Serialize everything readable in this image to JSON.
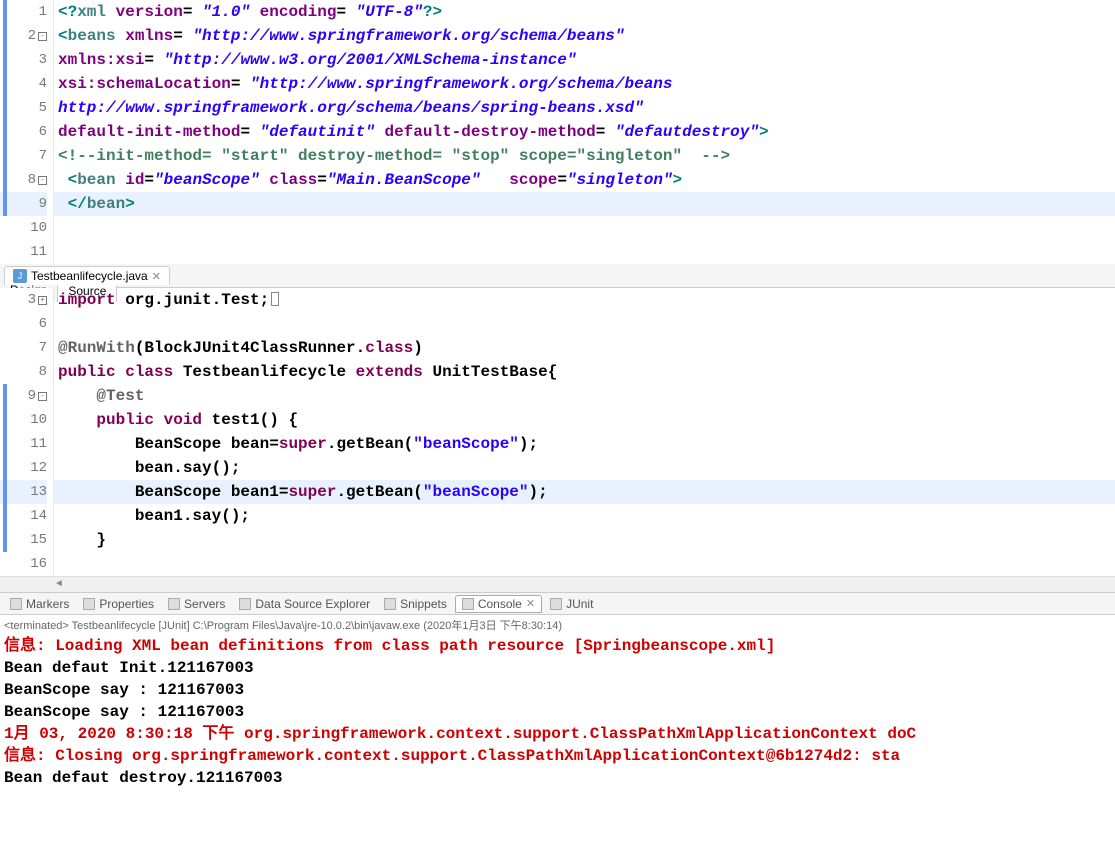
{
  "xml_editor": {
    "lines": [
      {
        "n": "1",
        "marker": "strip"
      },
      {
        "n": "2",
        "marker": "box-minus strip"
      },
      {
        "n": "3",
        "marker": "strip"
      },
      {
        "n": "4",
        "marker": "strip"
      },
      {
        "n": "5",
        "marker": "strip"
      },
      {
        "n": "6",
        "marker": "strip"
      },
      {
        "n": "7",
        "marker": "strip"
      },
      {
        "n": "8",
        "marker": "box-minus strip"
      },
      {
        "n": "9",
        "marker": "strip",
        "hl": true
      },
      {
        "n": "10",
        "marker": ""
      },
      {
        "n": "11",
        "marker": ""
      }
    ],
    "tokens": {
      "l1": {
        "a": "<?",
        "b": "xml ",
        "c": "version",
        "d": "= ",
        "e": "\"1.0\"",
        "f": " encoding",
        "g": "= ",
        "h": "\"UTF-8\"",
        "i": "?>"
      },
      "l2": {
        "a": "<",
        "b": "beans ",
        "c": "xmlns",
        "d": "= ",
        "e": "\"http://www.springframework.org/schema/beans\""
      },
      "l3": {
        "a": "xmlns:xsi",
        "b": "= ",
        "c": "\"http://www.w3.org/2001/XMLSchema-instance\""
      },
      "l4": {
        "a": "xsi:schemaLocation",
        "b": "= ",
        "c": "\"http://www.springframework.org/schema/beans"
      },
      "l5": {
        "a": "http://www.springframework.org/schema/beans/spring-beans.xsd\""
      },
      "l6": {
        "a": "default-init-method",
        "b": "= ",
        "c": "\"defautinit\"",
        "d": " default-destroy-method",
        "e": "= ",
        "f": "\"defautdestroy\"",
        "g": ">"
      },
      "l7": {
        "a": "<!--init-method= \"start\" destroy-method= \"stop\" scope=\"singleton\"  -->"
      },
      "l8": {
        "a": " <",
        "b": "bean ",
        "c": "id",
        "d": "=",
        "e": "\"beanScope\"",
        "f": " class",
        "g": "=",
        "h": "\"Main.BeanScope\"",
        "i": "   scope",
        "j": "=",
        "k": "\"singleton\"",
        "l": ">"
      },
      "l9": {
        "a": " </",
        "b": "bean",
        "c": ">"
      }
    },
    "tabs": {
      "design": "Design",
      "source": "Source"
    }
  },
  "java_file_tab": {
    "label": "Testbeanlifecycle.java"
  },
  "java_editor": {
    "lines": [
      {
        "n": "3",
        "marker": "box-plus"
      },
      {
        "n": "6"
      },
      {
        "n": "7"
      },
      {
        "n": "8"
      },
      {
        "n": "9",
        "marker": "box-minus strip"
      },
      {
        "n": "10",
        "marker": "strip"
      },
      {
        "n": "11",
        "marker": "strip"
      },
      {
        "n": "12",
        "marker": "strip"
      },
      {
        "n": "13",
        "marker": "strip",
        "hl": true
      },
      {
        "n": "14",
        "marker": "strip"
      },
      {
        "n": "15",
        "marker": "strip"
      },
      {
        "n": "16"
      }
    ],
    "tokens": {
      "l3": {
        "a": "import",
        "b": " org.junit.Test;"
      },
      "l7": {
        "a": "@RunWith",
        "b": "(BlockJUnit4ClassRunner.",
        "c": "class",
        "d": ")"
      },
      "l8": {
        "a": "public",
        "b": " class",
        "c": " Testbeanlifecycle ",
        "d": "extends",
        "e": " UnitTestBase{"
      },
      "l9": {
        "a": "    @Test"
      },
      "l10": {
        "a": "    ",
        "b": "public",
        "c": " void",
        "d": " test1() {"
      },
      "l11": {
        "a": "        BeanScope bean=",
        "b": "super",
        "c": ".getBean(",
        "d": "\"beanScope\"",
        "e": ");"
      },
      "l12": {
        "a": "        bean.say();"
      },
      "l13": {
        "a": "        BeanScope bean1=",
        "b": "super",
        "c": ".getBean(",
        "d": "\"beanScope\"",
        "e": ");"
      },
      "l14": {
        "a": "        bean1.say();"
      },
      "l15": {
        "a": "    }"
      }
    }
  },
  "views": {
    "markers": "Markers",
    "properties": "Properties",
    "servers": "Servers",
    "dse": "Data Source Explorer",
    "snippets": "Snippets",
    "console": "Console",
    "junit": "JUnit"
  },
  "console": {
    "terminated": "<terminated> Testbeanlifecycle [JUnit] C:\\Program Files\\Java\\jre-10.0.2\\bin\\javaw.exe (2020年1月3日 下午8:30:14)",
    "lines": [
      {
        "cls": "c-red",
        "t": "信息: Loading XML bean definitions from class path resource [Springbeanscope.xml]"
      },
      {
        "cls": "c-blk",
        "t": "Bean defaut Init.121167003"
      },
      {
        "cls": "c-blk",
        "t": "BeanScope say : 121167003"
      },
      {
        "cls": "c-blk",
        "t": "BeanScope say : 121167003"
      },
      {
        "cls": "c-red",
        "t": "1月 03, 2020 8:30:18 下午 org.springframework.context.support.ClassPathXmlApplicationContext doC"
      },
      {
        "cls": "c-red",
        "t": "信息: Closing org.springframework.context.support.ClassPathXmlApplicationContext@6b1274d2: sta"
      },
      {
        "cls": "c-blk",
        "t": "Bean defaut destroy.121167003"
      }
    ]
  }
}
